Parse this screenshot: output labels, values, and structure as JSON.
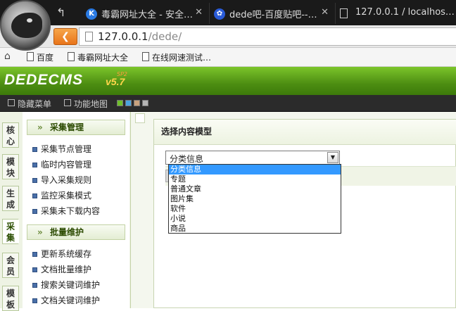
{
  "browser": {
    "tabs": [
      {
        "title": "毒霸网址大全 - 安全…",
        "icon": "k-icon",
        "icon_color": "#2a7ae2"
      },
      {
        "title": "dede吧-百度贴吧--…",
        "icon": "paw-icon",
        "icon_color": "#2a5bd7"
      },
      {
        "title": "127.0.0.1 / localhos…",
        "icon": "page-icon",
        "icon_color": "#ffffff"
      }
    ],
    "url_host": "127.0.0.1",
    "url_path": "/dede/",
    "bookmarks": [
      "百度",
      "毒霸网址大全",
      "在线网速测试…"
    ]
  },
  "dede": {
    "logo_text": "DEDECMS",
    "version": "v5.7",
    "edition": "SP2",
    "toolbar": {
      "hide_menu": "隐藏菜单",
      "site_map": "功能地图"
    },
    "swatches": [
      "#6fbf2a",
      "#4aa3df",
      "#c9a27e",
      "#b5b5b5"
    ]
  },
  "vertical_tabs": [
    "核心",
    "模块",
    "生成",
    "采集",
    "会员",
    "模板"
  ],
  "menu": {
    "section1": {
      "title": "采集管理",
      "items": [
        "采集节点管理",
        "临时内容管理",
        "导入采集规则",
        "监控采集模式",
        "采集未下载内容"
      ]
    },
    "section2": {
      "title": "批量维护",
      "items": [
        "更新系统缓存",
        "文档批量维护",
        "搜索关键词维护",
        "文档关键词维护"
      ]
    }
  },
  "main": {
    "panel_title": "选择内容模型",
    "select_value": "分类信息",
    "options": [
      "分类信息",
      "专题",
      "普通文章",
      "图片集",
      "软件",
      "小说",
      "商品"
    ],
    "selected_option": "分类信息"
  }
}
